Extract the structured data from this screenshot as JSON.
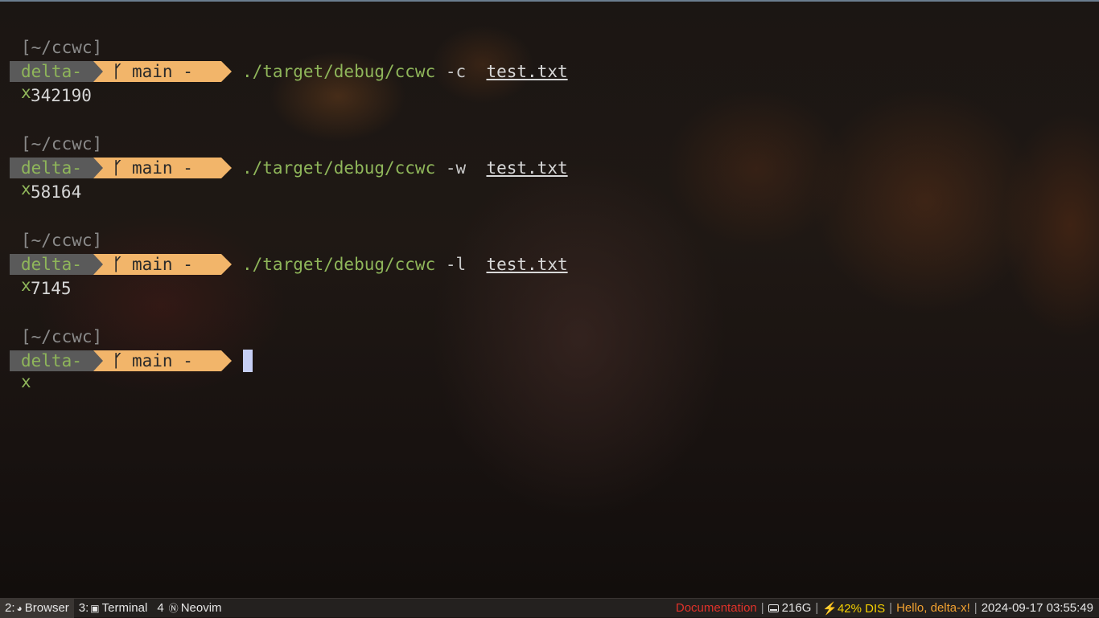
{
  "terminal": {
    "blocks": [
      {
        "cwd": "[~/ccwc]",
        "host": "delta-x",
        "branch": "main -",
        "command": "./target/debug/ccwc",
        "flag": "-c",
        "file": "test.txt",
        "output": "342190"
      },
      {
        "cwd": "[~/ccwc]",
        "host": "delta-x",
        "branch": "main -",
        "command": "./target/debug/ccwc",
        "flag": "-w",
        "file": "test.txt",
        "output": "58164"
      },
      {
        "cwd": "[~/ccwc]",
        "host": "delta-x",
        "branch": "main -",
        "command": "./target/debug/ccwc",
        "flag": "-l",
        "file": "test.txt",
        "output": "7145"
      },
      {
        "cwd": "[~/ccwc]",
        "host": "delta-x",
        "branch": "main -"
      }
    ],
    "branch_icon": "git-branch-icon",
    "colors": {
      "host_bg": "#5a5a5a",
      "host_fg": "#8fb65a",
      "git_bg": "#f2b56a",
      "cursor": "#c6cff5"
    }
  },
  "statusbar": {
    "workspaces": [
      {
        "num": "2:",
        "icon": "browser-icon",
        "label": "Browser"
      },
      {
        "num": "3:",
        "icon": "terminal-icon",
        "label": "Terminal"
      },
      {
        "num": "4",
        "icon": "neovim-icon",
        "label": "Neovim"
      }
    ],
    "documentation": "Documentation",
    "disk": "216G",
    "battery": "42% DIS",
    "greeting": "Hello, delta-x!",
    "datetime": "2024-09-17 03:55:49",
    "separator": "|"
  }
}
